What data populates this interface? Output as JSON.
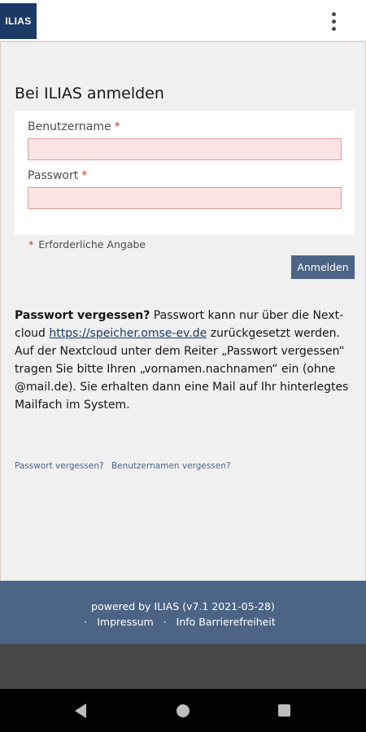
{
  "header": {
    "logo_text": "ILIAS",
    "menu_icon": "kebab-menu-icon"
  },
  "login": {
    "title": "Bei ILIAS anmelden",
    "username_label": "Benutzername",
    "password_label": "Passwort",
    "required_marker": "*",
    "required_note": "Erforderliche Angabe",
    "submit_label": "Anmelden"
  },
  "info": {
    "bold": "Passwort vergessen?",
    "text1": " Passwort kann nur über die Next-cloud ",
    "link": "https://speicher.omse-ev.de",
    "text2": " zurückgesetzt werden. Auf der Nextcloud unter dem Reiter „Passwort vergessen“ tragen Sie bitte Ihren „vornamen.nachnamen“ ein (ohne @mail.de). Sie erhalten dann eine Mail auf Ihr hinterlegtes Mailfach im System."
  },
  "links": {
    "forgot_password": "Passwort vergessen?",
    "forgot_username": "Benutzernamen vergessen?"
  },
  "footer": {
    "powered_by": "powered by ILIAS (v7.1 2021-05-28)",
    "bullet": "·",
    "imprint": "Impressum",
    "accessibility": "Info Barrierefreiheit"
  },
  "colors": {
    "brand": "#1c3a66",
    "accent": "#4c6586",
    "required": "#c0392b",
    "field_error_bg": "#fde4e4"
  }
}
